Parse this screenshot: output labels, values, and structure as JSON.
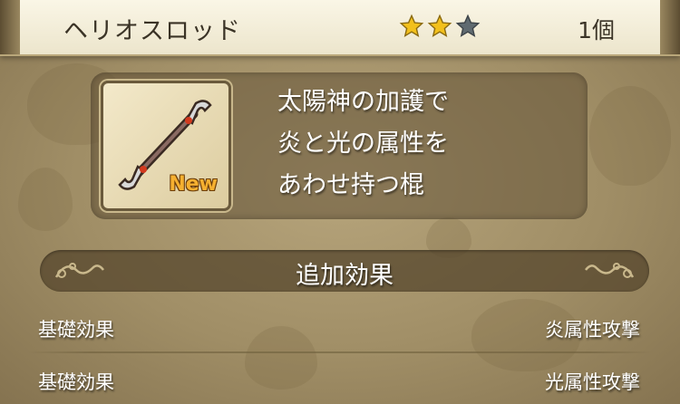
{
  "header": {
    "item_name": "ヘリオスロッド",
    "rarity": {
      "filled": 2,
      "total": 3
    },
    "count": "1個"
  },
  "item": {
    "icon": "rod-icon",
    "badge": "New",
    "description_lines": [
      "太陽神の加護で",
      "炎と光の属性を",
      "あわせ持つ棍"
    ]
  },
  "effects": {
    "title": "追加効果",
    "rows": [
      {
        "label": "基礎効果",
        "value": "炎属性攻撃"
      },
      {
        "label": "基礎効果",
        "value": "光属性攻撃"
      }
    ]
  },
  "colors": {
    "star_filled": "#f2c01c",
    "star_empty": "#5f6a70",
    "badge": "#f5b030"
  }
}
